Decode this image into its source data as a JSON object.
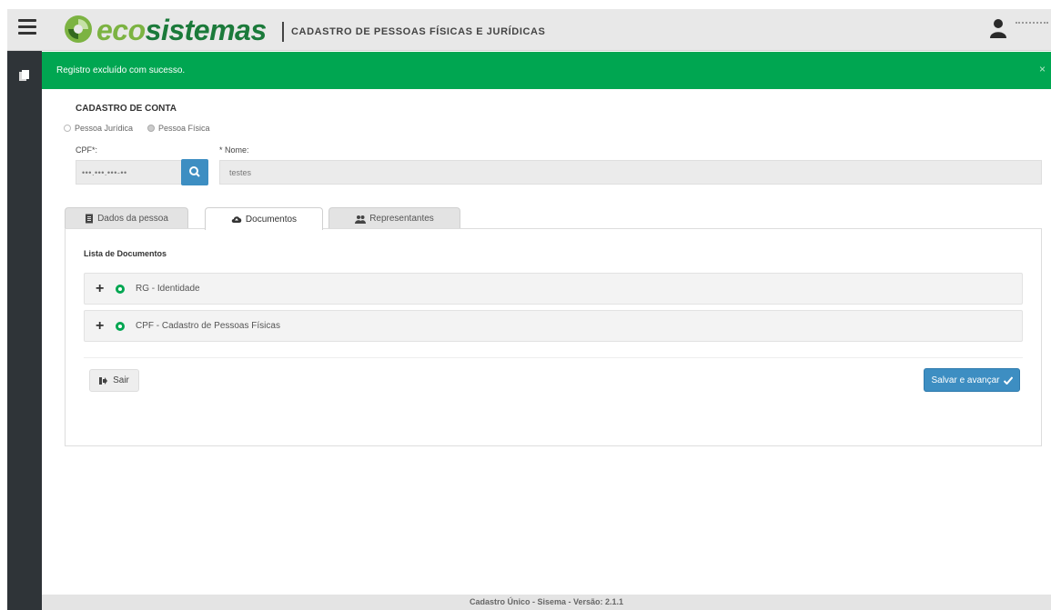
{
  "header": {
    "brand_eco": "eco",
    "brand_sistemas": "sistemas",
    "subtitle": "CADASTRO DE PESSOAS FÍSICAS E JURÍDICAS",
    "menu_icon": "hamburger-icon",
    "user_icon": "user-icon",
    "colors": {
      "eco": "#7cb342",
      "sistemas": "#1b7a3a",
      "bar": "#e8e8e8"
    }
  },
  "sidebar": {
    "icon": "file-icon",
    "color": "#2f3438"
  },
  "alert": {
    "message": "Registro excluído com sucesso.",
    "close": "×",
    "color": "#00a651"
  },
  "form": {
    "title": "CADASTRO DE CONTA",
    "person_type": {
      "options": [
        "Pessoa Jurídica",
        "Pessoa Física"
      ],
      "selected": "Pessoa Física"
    },
    "cpf": {
      "label": "CPF*:",
      "value": "•••.•••.•••-••"
    },
    "nome": {
      "label": "* Nome:",
      "value": "testes"
    }
  },
  "tabs": [
    {
      "label": "Dados da pessoa",
      "icon": "document-icon",
      "active": false
    },
    {
      "label": "Documentos",
      "icon": "cloud-upload-icon",
      "active": true
    },
    {
      "label": "Representantes",
      "icon": "users-icon",
      "active": false
    }
  ],
  "documents": {
    "title": "Lista de Documentos",
    "items": [
      {
        "label": "RG - Identidade",
        "status": "ok"
      },
      {
        "label": "CPF - Cadastro de Pessoas Físicas",
        "status": "ok"
      }
    ]
  },
  "actions": {
    "exit_label": "Sair",
    "save_label": "Salvar e avançar",
    "save_color": "#3d8ec2"
  },
  "footer": {
    "text": "Cadastro Único - Sisema - Versão: 2.1.1"
  }
}
